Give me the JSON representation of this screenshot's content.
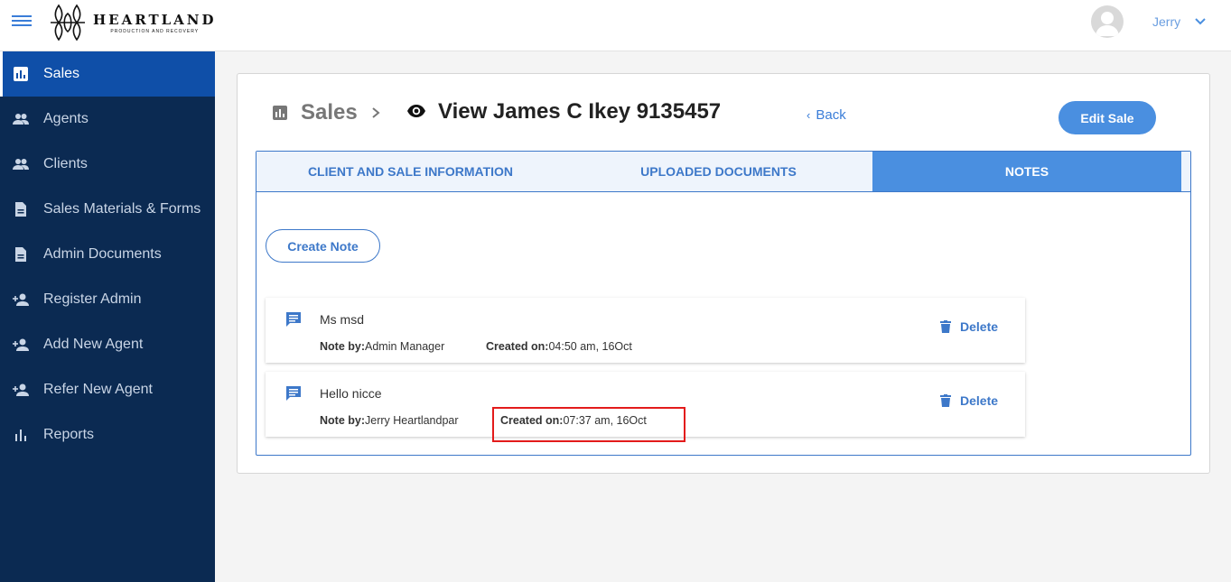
{
  "brand": {
    "name": "HEARTLAND",
    "tagline": "PRODUCTION AND RECOVERY"
  },
  "user": {
    "name": "Jerry"
  },
  "sidebar": {
    "items": [
      {
        "label": "Sales",
        "icon": "bar-chart-icon",
        "active": true
      },
      {
        "label": "Agents",
        "icon": "people-icon"
      },
      {
        "label": "Clients",
        "icon": "people-icon"
      },
      {
        "label": "Sales Materials & Forms",
        "icon": "document-icon"
      },
      {
        "label": "Admin Documents",
        "icon": "document-icon"
      },
      {
        "label": "Register Admin",
        "icon": "person-add-icon"
      },
      {
        "label": "Add New Agent",
        "icon": "person-add-icon"
      },
      {
        "label": "Refer New Agent",
        "icon": "person-add-icon"
      },
      {
        "label": "Reports",
        "icon": "bar-chart-icon"
      }
    ]
  },
  "header": {
    "breadcrumb_root": "Sales",
    "title": "View James C Ikey 9135457",
    "back_label": "Back",
    "edit_label": "Edit Sale"
  },
  "tabs": [
    {
      "label": "CLIENT AND SALE INFORMATION"
    },
    {
      "label": "UPLOADED DOCUMENTS"
    },
    {
      "label": "NOTES",
      "active": true
    }
  ],
  "notes_section": {
    "create_label": "Create Note",
    "note_by_label": "Note by:",
    "created_on_label": "Created on:",
    "delete_label": "Delete",
    "notes": [
      {
        "text": "Ms msd",
        "author": "Admin Manager",
        "created": "04:50 am, 16Oct"
      },
      {
        "text": "Hello nicce",
        "author": "Jerry Heartlandpar",
        "created": "07:37 am, 16Oct"
      }
    ]
  },
  "colors": {
    "sidebar_bg": "#0b2a52",
    "sidebar_active": "#0f4fa8",
    "accent": "#4a8fe0",
    "highlight": "#e31b1b"
  }
}
